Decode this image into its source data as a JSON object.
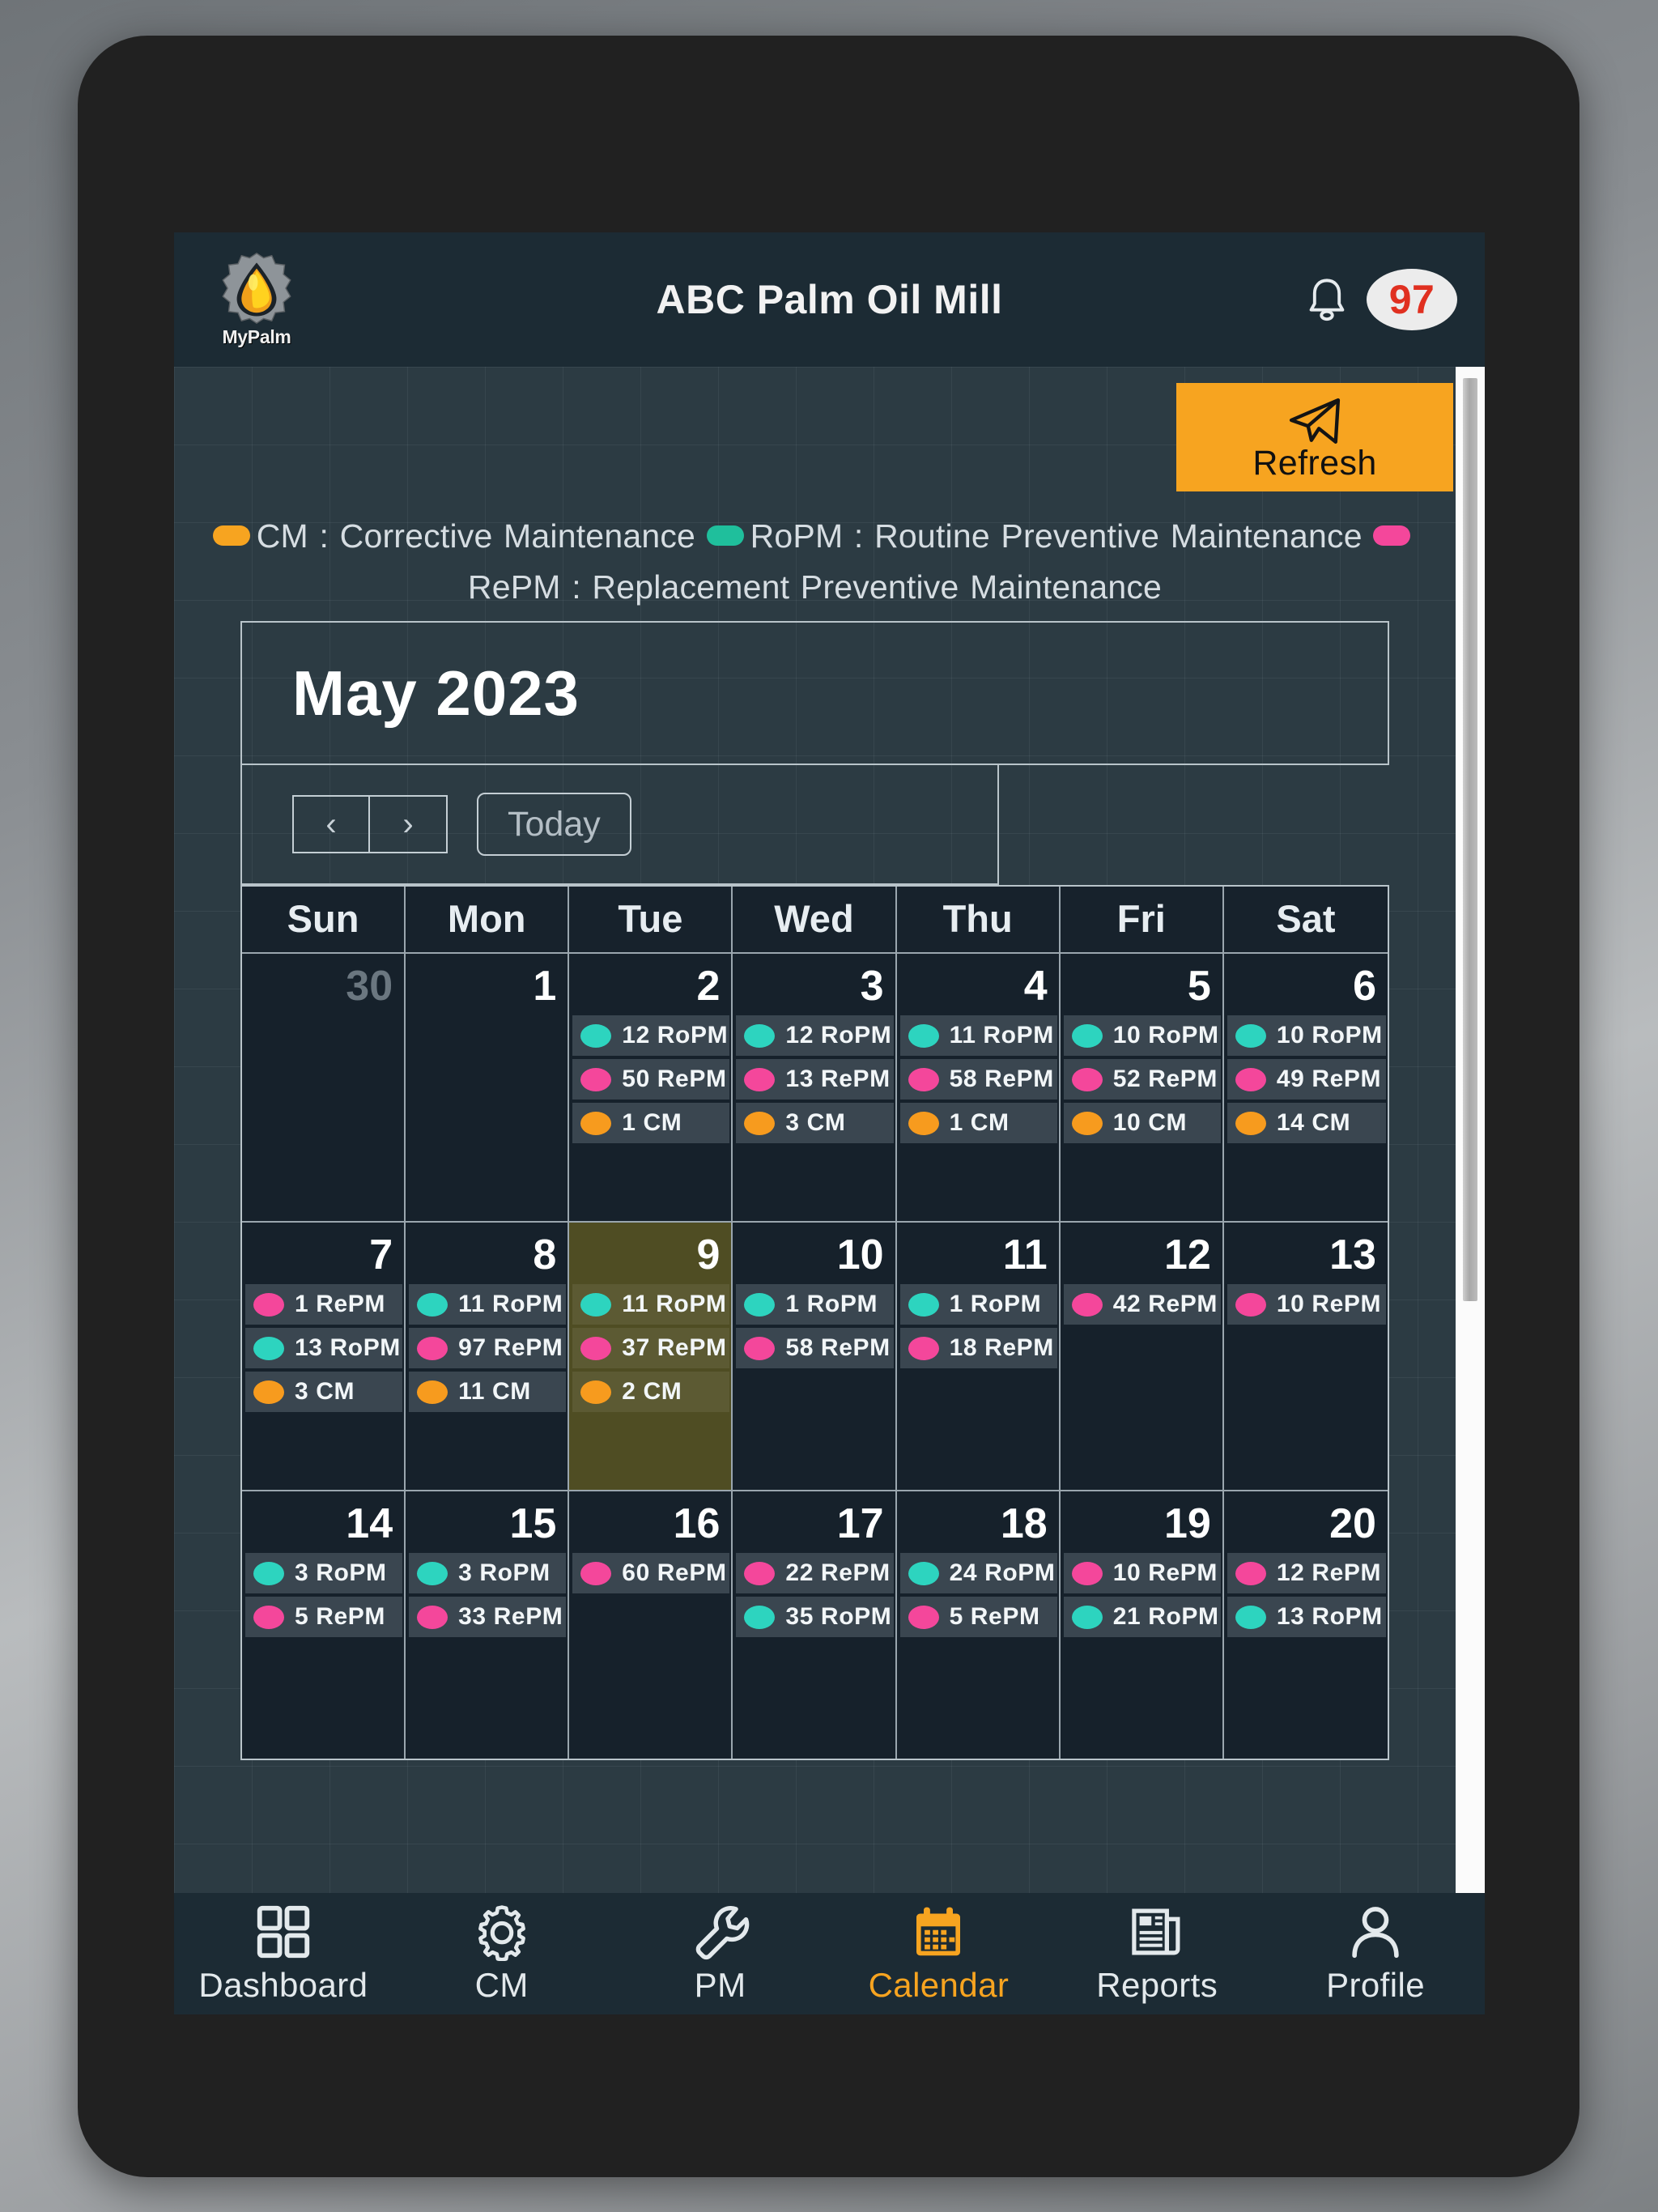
{
  "header": {
    "logo_text": "MyPalm",
    "logo_icon": "palm-oil-drop-gear-icon",
    "title": "ABC Palm Oil Mill",
    "bell_icon": "notification-bell-icon",
    "notification_count": "97"
  },
  "toolbar": {
    "refresh_label": "Refresh",
    "refresh_icon": "send-paper-plane-icon"
  },
  "legend": {
    "cm_code": "CM",
    "cm_sep": " : ",
    "cm_text": "Corrective Maintenance",
    "ropm_code": "RoPM",
    "ropm_sep": " : ",
    "ropm_text": "Routine Preventive Maintenance",
    "repm_code": "RePM",
    "repm_sep": " : ",
    "repm_text": "Replacement Preventive Maintenance",
    "colors": {
      "cm": "#f7a420",
      "ropm": "#1fbf9c",
      "repm": "#f4479b"
    }
  },
  "calendar": {
    "title": "May 2023",
    "prev_label": "‹",
    "next_label": "›",
    "today_label": "Today",
    "weekdays": [
      "Sun",
      "Mon",
      "Tue",
      "Wed",
      "Thu",
      "Fri",
      "Sat"
    ],
    "weeks": [
      {
        "days": [
          {
            "num": "30",
            "other": true,
            "today": false,
            "events": []
          },
          {
            "num": "1",
            "other": false,
            "today": false,
            "events": []
          },
          {
            "num": "2",
            "other": false,
            "today": false,
            "events": [
              {
                "type": "ropm",
                "label": "12 RoPM"
              },
              {
                "type": "repm",
                "label": "50 RePM"
              },
              {
                "type": "cm",
                "label": "1 CM"
              }
            ]
          },
          {
            "num": "3",
            "other": false,
            "today": false,
            "events": [
              {
                "type": "ropm",
                "label": "12 RoPM"
              },
              {
                "type": "repm",
                "label": "13 RePM"
              },
              {
                "type": "cm",
                "label": "3 CM"
              }
            ]
          },
          {
            "num": "4",
            "other": false,
            "today": false,
            "events": [
              {
                "type": "ropm",
                "label": "11 RoPM"
              },
              {
                "type": "repm",
                "label": "58 RePM"
              },
              {
                "type": "cm",
                "label": "1 CM"
              }
            ]
          },
          {
            "num": "5",
            "other": false,
            "today": false,
            "events": [
              {
                "type": "ropm",
                "label": "10 RoPM"
              },
              {
                "type": "repm",
                "label": "52 RePM"
              },
              {
                "type": "cm",
                "label": "10 CM"
              }
            ]
          },
          {
            "num": "6",
            "other": false,
            "today": false,
            "events": [
              {
                "type": "ropm",
                "label": "10 RoPM"
              },
              {
                "type": "repm",
                "label": "49 RePM"
              },
              {
                "type": "cm",
                "label": "14 CM"
              }
            ]
          }
        ]
      },
      {
        "days": [
          {
            "num": "7",
            "other": false,
            "today": false,
            "events": [
              {
                "type": "repm",
                "label": "1 RePM"
              },
              {
                "type": "ropm",
                "label": "13 RoPM"
              },
              {
                "type": "cm",
                "label": "3 CM"
              }
            ]
          },
          {
            "num": "8",
            "other": false,
            "today": false,
            "events": [
              {
                "type": "ropm",
                "label": "11 RoPM"
              },
              {
                "type": "repm",
                "label": "97 RePM"
              },
              {
                "type": "cm",
                "label": "11 CM"
              }
            ]
          },
          {
            "num": "9",
            "other": false,
            "today": true,
            "events": [
              {
                "type": "ropm",
                "label": "11 RoPM"
              },
              {
                "type": "repm",
                "label": "37 RePM"
              },
              {
                "type": "cm",
                "label": "2 CM"
              }
            ]
          },
          {
            "num": "10",
            "other": false,
            "today": false,
            "events": [
              {
                "type": "ropm",
                "label": "1 RoPM"
              },
              {
                "type": "repm",
                "label": "58 RePM"
              }
            ]
          },
          {
            "num": "11",
            "other": false,
            "today": false,
            "events": [
              {
                "type": "ropm",
                "label": "1 RoPM"
              },
              {
                "type": "repm",
                "label": "18 RePM"
              }
            ]
          },
          {
            "num": "12",
            "other": false,
            "today": false,
            "events": [
              {
                "type": "repm",
                "label": "42 RePM"
              }
            ]
          },
          {
            "num": "13",
            "other": false,
            "today": false,
            "events": [
              {
                "type": "repm",
                "label": "10 RePM"
              }
            ]
          }
        ]
      },
      {
        "days": [
          {
            "num": "14",
            "other": false,
            "today": false,
            "events": [
              {
                "type": "ropm",
                "label": "3 RoPM"
              },
              {
                "type": "repm",
                "label": "5 RePM"
              }
            ]
          },
          {
            "num": "15",
            "other": false,
            "today": false,
            "events": [
              {
                "type": "ropm",
                "label": "3 RoPM"
              },
              {
                "type": "repm",
                "label": "33 RePM"
              }
            ]
          },
          {
            "num": "16",
            "other": false,
            "today": false,
            "events": [
              {
                "type": "repm",
                "label": "60 RePM"
              }
            ]
          },
          {
            "num": "17",
            "other": false,
            "today": false,
            "events": [
              {
                "type": "repm",
                "label": "22 RePM"
              },
              {
                "type": "ropm",
                "label": "35 RoPM"
              }
            ]
          },
          {
            "num": "18",
            "other": false,
            "today": false,
            "events": [
              {
                "type": "ropm",
                "label": "24 RoPM"
              },
              {
                "type": "repm",
                "label": "5 RePM"
              }
            ]
          },
          {
            "num": "19",
            "other": false,
            "today": false,
            "events": [
              {
                "type": "repm",
                "label": "10 RePM"
              },
              {
                "type": "ropm",
                "label": "21 RoPM"
              }
            ]
          },
          {
            "num": "20",
            "other": false,
            "today": false,
            "events": [
              {
                "type": "repm",
                "label": "12 RePM"
              },
              {
                "type": "ropm",
                "label": "13 RoPM"
              }
            ]
          }
        ]
      }
    ]
  },
  "bottom_nav": {
    "items": [
      {
        "label": "Dashboard",
        "icon": "grid-squares-icon",
        "active": false
      },
      {
        "label": "CM",
        "icon": "gear-icon",
        "active": false
      },
      {
        "label": "PM",
        "icon": "wrench-icon",
        "active": false
      },
      {
        "label": "Calendar",
        "icon": "calendar-icon",
        "active": true
      },
      {
        "label": "Reports",
        "icon": "newspaper-icon",
        "active": false
      },
      {
        "label": "Profile",
        "icon": "person-icon",
        "active": false
      }
    ],
    "active_color": "#f7a420"
  }
}
